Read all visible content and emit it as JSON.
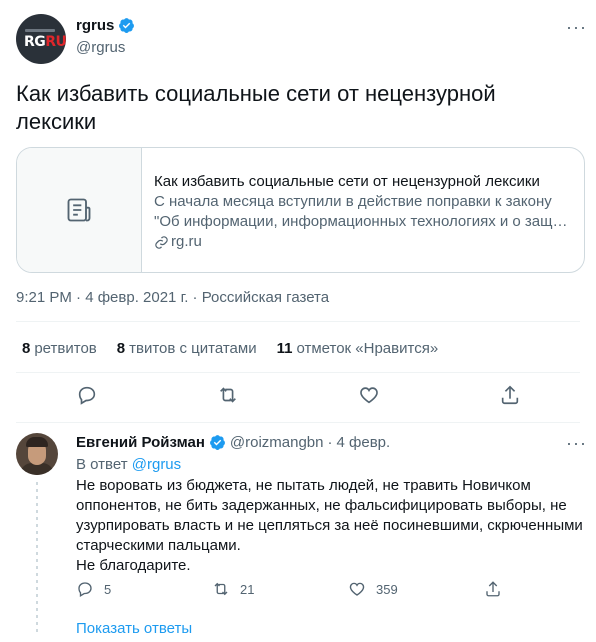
{
  "tweet": {
    "avatar_logo_rg": "RG",
    "avatar_logo_ru": "RU",
    "author_name": "rgrus",
    "author_handle": "@rgrus",
    "text": "Как избавить социальные сети от нецензурной лексики",
    "card": {
      "title": "Как избавить социальные сети от нецензурной лексики",
      "desc_line1": "С начала месяца вступили в действие поправки к закону",
      "desc_line2": "\"Об информации, информационных технологиях и о защи...",
      "domain": "rg.ru"
    },
    "meta": "9:21 PM · 4 февр. 2021 г. · Российская газета",
    "stats": {
      "retweets_count": "8",
      "retweets_label": "ретвитов",
      "quotes_count": "8",
      "quotes_label": "твитов с цитатами",
      "likes_count": "11",
      "likes_label": "отметок «Нравится»"
    }
  },
  "reply": {
    "author_name": "Евгений Ройзман",
    "author_handle": "@roizmangbn",
    "dot": "·",
    "date": "4 февр.",
    "reply_to_prefix": "В ответ",
    "reply_to_handle": "@rgrus",
    "body_line1": "Не воровать из бюджета, не пытать людей, не травить Новичком",
    "body_line2": "оппонентов, не бить задержанных, не фальсифицировать выборы, не",
    "body_line3": "узурпировать власть и не цепляться за неё посиневшими, скрюченными",
    "body_line4": "старческими пальцами.",
    "body_line5": "Не благодарите.",
    "replies_count": "5",
    "retweets_count": "21",
    "likes_count": "359"
  },
  "show_replies": "Показать ответы",
  "more_glyph": "···",
  "colors": {
    "accent": "#1d9bf0",
    "secondary_text": "#536471",
    "border": "#cfd9de"
  },
  "icons": [
    "verified-badge-icon",
    "more-icon",
    "article-icon",
    "link-icon",
    "reply-icon",
    "retweet-icon",
    "like-icon",
    "share-icon"
  ]
}
